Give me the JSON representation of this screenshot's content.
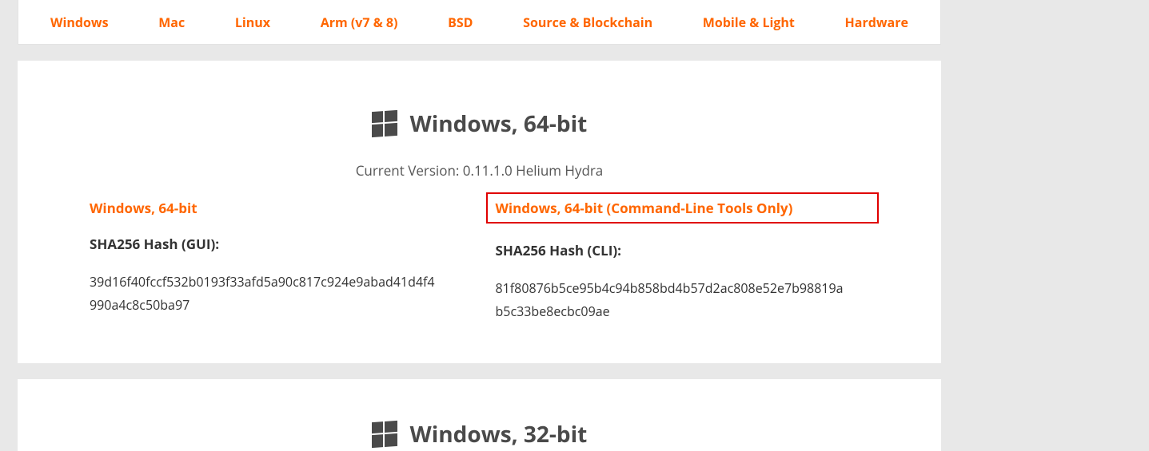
{
  "tabs": [
    "Windows",
    "Mac",
    "Linux",
    "Arm (v7 & 8)",
    "BSD",
    "Source & Blockchain",
    "Mobile & Light",
    "Hardware"
  ],
  "card64": {
    "title": "Windows, 64-bit",
    "version": "Current Version: 0.11.1.0 Helium Hydra",
    "left": {
      "link": "Windows, 64-bit",
      "hash_label": "SHA256 Hash (GUI):",
      "hash_value": "39d16f40fccf532b0193f33afd5a90c817c924e9abad41d4f4990a4c8c50ba97"
    },
    "right": {
      "link": "Windows, 64-bit (Command-Line Tools Only)",
      "hash_label": "SHA256 Hash (CLI):",
      "hash_value": "81f80876b5ce95b4c94b858bd4b57d2ac808e52e7b98819ab5c33be8ecbc09ae"
    }
  },
  "card32": {
    "title": "Windows, 32-bit"
  }
}
